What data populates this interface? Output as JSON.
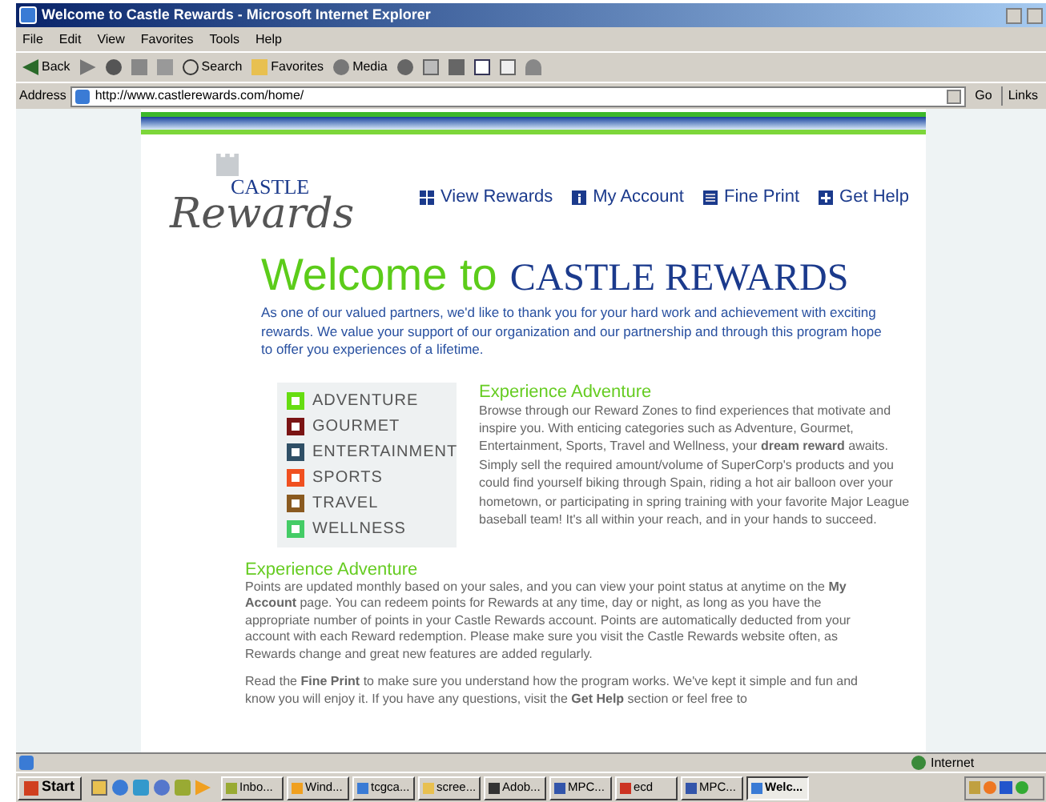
{
  "window": {
    "title": "Welcome to Castle Rewards - Microsoft Internet Explorer"
  },
  "menu_bar": [
    "File",
    "Edit",
    "View",
    "Favorites",
    "Tools",
    "Help"
  ],
  "toolbar": [
    {
      "kind": "back",
      "label": "Back"
    },
    {
      "kind": "forward"
    },
    {
      "kind": "stop"
    },
    {
      "kind": "refresh"
    },
    {
      "kind": "home"
    },
    {
      "kind": "search",
      "label": "Search"
    },
    {
      "kind": "favorites",
      "label": "Favorites"
    },
    {
      "kind": "media",
      "label": "Media"
    },
    {
      "kind": "history"
    },
    {
      "kind": "mail"
    },
    {
      "kind": "print"
    },
    {
      "kind": "edit"
    },
    {
      "kind": "discuss"
    },
    {
      "kind": "messenger"
    }
  ],
  "address_bar": {
    "label": "Address",
    "url": "http://www.castlerewards.com/home/",
    "go": "Go",
    "links": "Links"
  },
  "page": {
    "logo": {
      "top": "CASTLE",
      "script": "Rewards"
    },
    "nav": [
      "View Rewards",
      "My Account",
      "Fine Print",
      "Get Help"
    ],
    "heading": {
      "lead": "Welcome to",
      "brand": "CASTLE REWARDS"
    },
    "intro": "As one of our valued partners, we'd like to thank you for your hard work and achievement with exciting rewards. We value your support of our organization and our partnership and through this program hope to offer you experiences of a lifetime.",
    "categories": [
      {
        "label": "ADVENTURE",
        "color": "#66dd11"
      },
      {
        "label": "GOURMET",
        "color": "#7a1414"
      },
      {
        "label": "ENTERTAINMENT",
        "color": "#2f4f66"
      },
      {
        "label": "SPORTS",
        "color": "#f05020"
      },
      {
        "label": "TRAVEL",
        "color": "#8a5a20"
      },
      {
        "label": "WELLNESS",
        "color": "#44cc66"
      }
    ],
    "feature": {
      "title": "Experience Adventure",
      "text": "Browse through our Reward Zones to find experiences that motivate and inspire you. With enticing categories such as Adventure, Gourmet, Entertainment, Sports, Travel and Wellness, your **dream reward** awaits. Simply sell the required amount/volume of SuperCorp's products and you could find yourself biking through Spain, riding a hot air balloon over your hometown, or participating in spring training with your favorite Major League baseball team! It's all within your reach, and in your hands to succeed."
    },
    "section": {
      "title": "Experience Adventure",
      "paragraphs": [
        "Points are updated monthly based on your sales, and you can view your point status at anytime on the **My Account** page. You can redeem points for Rewards at any time, day or night, as long as you have the appropriate number of points in your Castle Rewards account. Points are automatically deducted from your account with each Reward redemption. Please make sure you visit the Castle Rewards website often, as Rewards change and great new features are added regularly.",
        "Read the **Fine Print** to make sure you understand how the program works. We've kept it simple and fun and know you will enjoy it. If you have any questions, visit the **Get Help** section or feel free to"
      ]
    }
  },
  "status_bar": {
    "zone": "Internet"
  },
  "taskbar": {
    "start": "Start",
    "tasks": [
      {
        "label": "Inbo...",
        "selected": false
      },
      {
        "label": "Wind...",
        "selected": false
      },
      {
        "label": "tcgca...",
        "selected": false
      },
      {
        "label": "scree...",
        "selected": false
      },
      {
        "label": "Adob...",
        "selected": false
      },
      {
        "label": "MPC...",
        "selected": false
      },
      {
        "label": "ecd",
        "selected": false
      },
      {
        "label": "MPC...",
        "selected": false
      },
      {
        "label": "Welc...",
        "selected": true
      }
    ]
  }
}
